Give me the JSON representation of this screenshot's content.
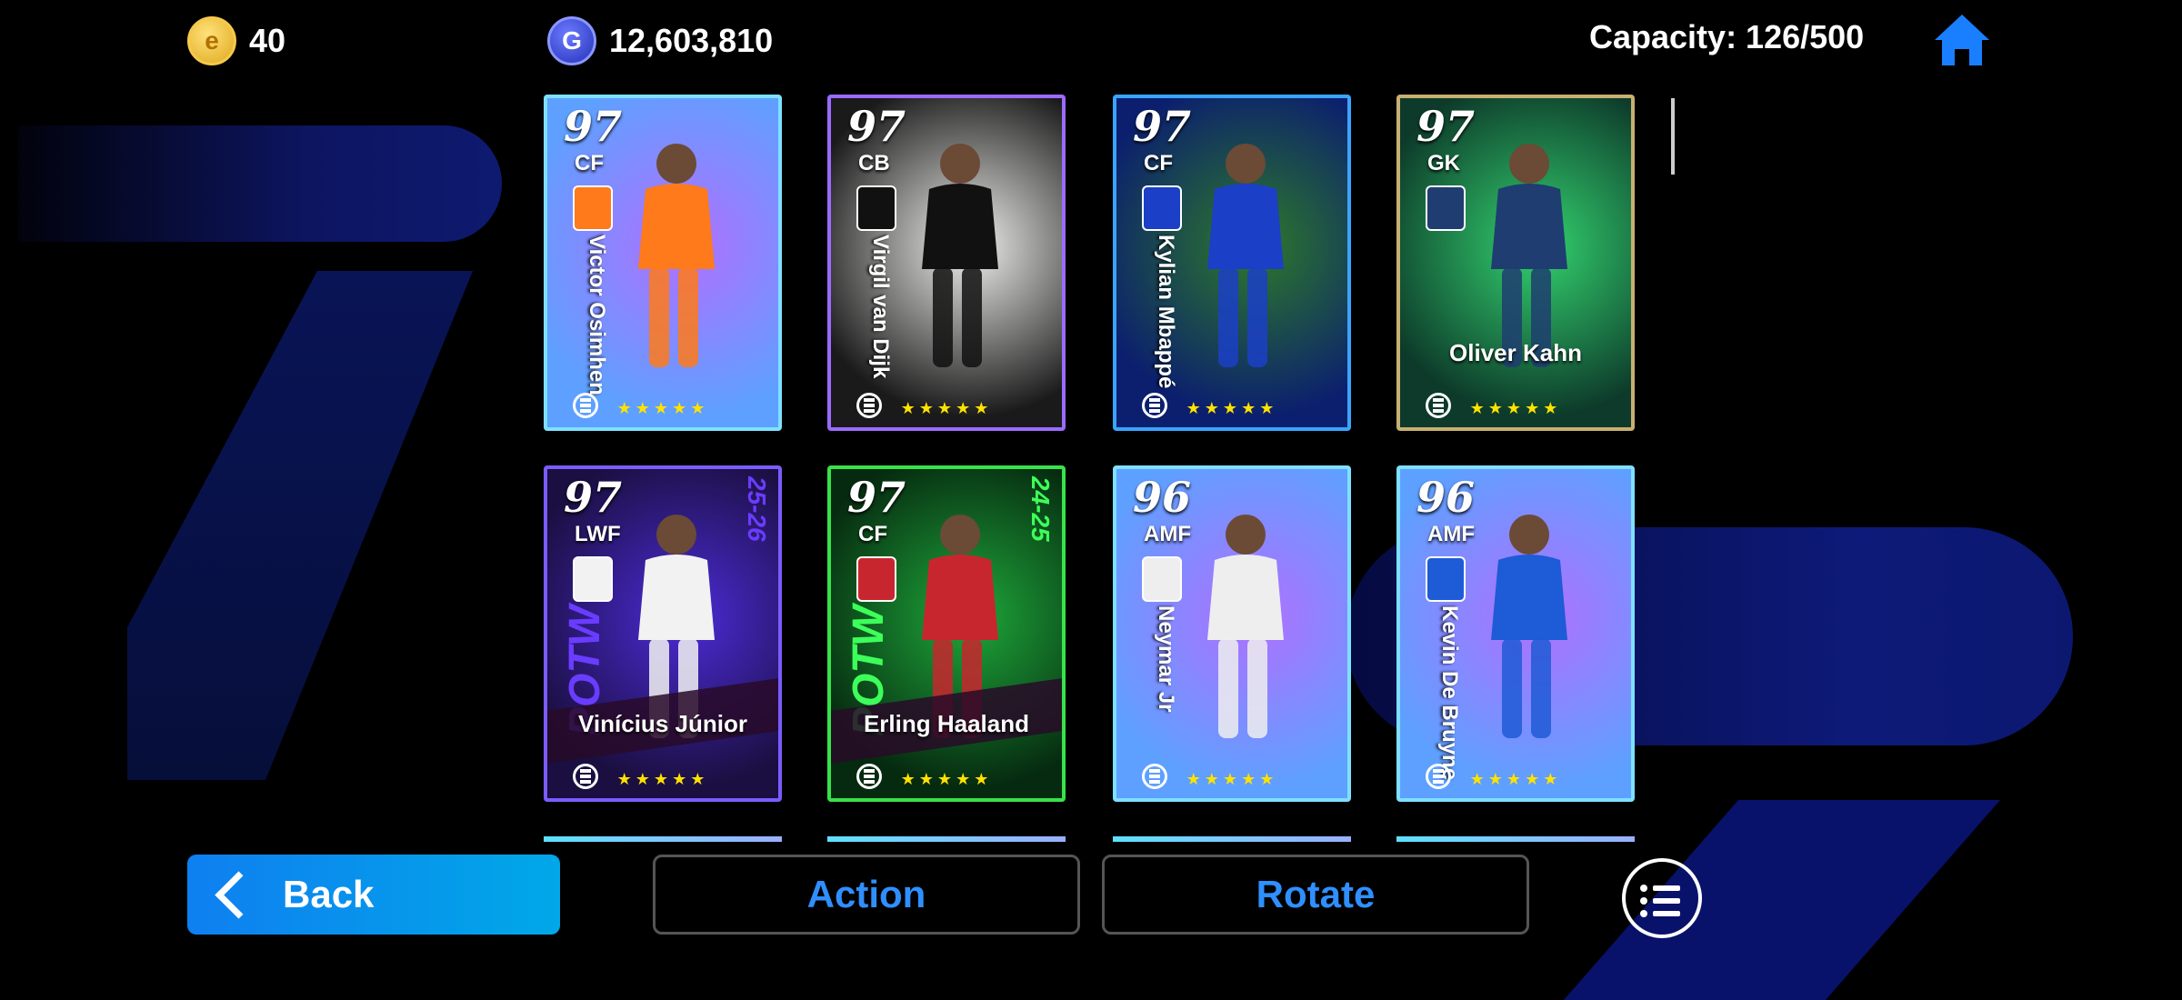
{
  "currency": {
    "ecoin_icon": "e-coin-icon",
    "ecoin_value": "40",
    "gp_icon": "gp-coin-icon",
    "gp_icon_letter": "G",
    "gp_value": "12,603,810"
  },
  "capacity": "Capacity: 126/500",
  "cards": [
    {
      "rating": "97",
      "position": "CF",
      "name": "Victor Osimhen",
      "name_style": "vertical",
      "border": "#7ee0ff",
      "bg": [
        "#5ea0ff",
        "#b070ff"
      ],
      "kit": "#ff7a1a",
      "stars": "★★★★★"
    },
    {
      "rating": "97",
      "position": "CB",
      "name": "Virgil van Dijk",
      "name_style": "vertical",
      "border": "#9b6bff",
      "bg": [
        "#1a1a1a",
        "#f0f0ee"
      ],
      "kit": "#111111",
      "stars": "★★★★★"
    },
    {
      "rating": "97",
      "position": "CF",
      "name": "Kylian Mbappé",
      "name_style": "vertical",
      "border": "#3aa4ff",
      "bg": [
        "#0b1f6e",
        "#2d7a2a"
      ],
      "kit": "#1b3fc7",
      "stars": "★★★★★"
    },
    {
      "rating": "97",
      "position": "GK",
      "name": "Oliver Kahn",
      "name_style": "horizontal",
      "border": "#c8b070",
      "bg": [
        "#0d3a2a",
        "#33d36f"
      ],
      "kit": "#1f3d70",
      "stars": "★★★★★"
    },
    {
      "rating": "97",
      "position": "LWF",
      "name": "Vinícius Júnior",
      "name_style": "slant",
      "border": "#7a5cff",
      "bg": [
        "#1a0f40",
        "#4c2bd8"
      ],
      "kit": "#f2f2f2",
      "stars": "★★★★★",
      "potw": "POTW",
      "season": "25-26",
      "potw_color": "#6a3cff"
    },
    {
      "rating": "97",
      "position": "CF",
      "name": "Erling Haaland",
      "name_style": "slant",
      "border": "#37e24a",
      "bg": [
        "#062a10",
        "#1ea83a"
      ],
      "kit": "#c8262e",
      "stars": "★★★★★",
      "potw": "POTW",
      "season": "24-25",
      "potw_color": "#3dff5a"
    },
    {
      "rating": "96",
      "position": "AMF",
      "name": "Neymar Jr",
      "name_style": "vertical",
      "border": "#7ee0ff",
      "bg": [
        "#5ea0ff",
        "#b070ff"
      ],
      "kit": "#eeeeee",
      "stars": "★★★★★"
    },
    {
      "rating": "96",
      "position": "AMF",
      "name": "Kevin De Bruyne",
      "name_style": "vertical",
      "border": "#7ee0ff",
      "bg": [
        "#5ea0ff",
        "#b070ff"
      ],
      "kit": "#1e5bd6",
      "stars": "★★★★★"
    }
  ],
  "buttons": {
    "back": "Back",
    "action": "Action",
    "rotate": "Rotate"
  },
  "icons": {
    "home": "home-icon",
    "menu": "list-menu-icon",
    "back": "chevron-left-icon"
  },
  "colors": {
    "accent_blue": "#2f8fff",
    "back_button": "#0f7ff0",
    "background": "#000000"
  }
}
